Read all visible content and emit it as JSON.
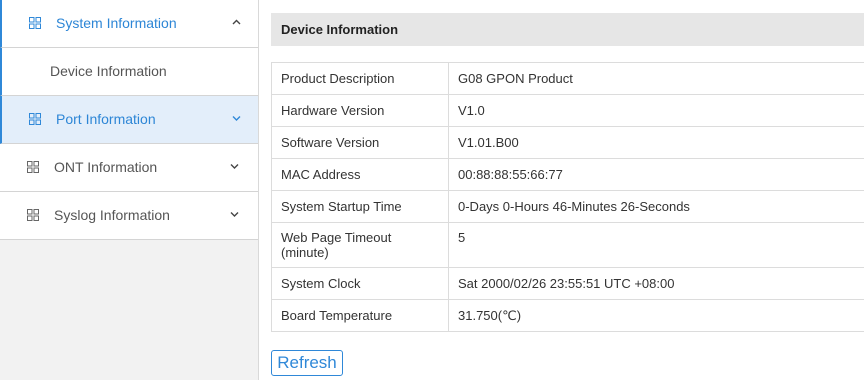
{
  "sidebar": {
    "items": [
      {
        "label": "System Information",
        "icon": "grid-icon"
      },
      {
        "label": "Device Information"
      },
      {
        "label": "Port Information",
        "icon": "grid-icon"
      },
      {
        "label": "ONT Information",
        "icon": "grid-icon"
      },
      {
        "label": "Syslog Information",
        "icon": "grid-icon"
      }
    ]
  },
  "main": {
    "section_title": "Device Information",
    "rows": [
      {
        "key": "Product Description",
        "value": "G08 GPON Product"
      },
      {
        "key": "Hardware Version",
        "value": "V1.0"
      },
      {
        "key": "Software Version",
        "value": "V1.01.B00"
      },
      {
        "key": "MAC Address",
        "value": "00:88:88:55:66:77"
      },
      {
        "key": "System Startup Time",
        "value": "0-Days 0-Hours 46-Minutes 26-Seconds"
      },
      {
        "key": "Web Page Timeout (minute)",
        "value": "5"
      },
      {
        "key": "System Clock",
        "value": "Sat 2000/02/26 23:55:51 UTC +08:00"
      },
      {
        "key": "Board Temperature",
        "value": "31.750(℃)"
      }
    ],
    "refresh_label": "Refresh"
  },
  "colors": {
    "accent": "#2f88d8",
    "active_bg": "#e3eefa",
    "header_bg": "#e6e6e6"
  }
}
